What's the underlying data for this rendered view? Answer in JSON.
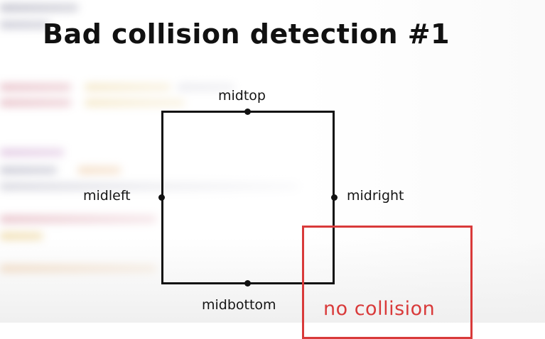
{
  "slide": {
    "title": "Bad collision detection #1"
  },
  "diagram": {
    "points": {
      "midtop": "midtop",
      "midleft": "midleft",
      "midright": "midright",
      "midbottom": "midbottom"
    },
    "result_label": "no collision"
  },
  "colors": {
    "box_outline": "#111111",
    "result_box": "#d93a3a",
    "result_text": "#d93a3a"
  }
}
